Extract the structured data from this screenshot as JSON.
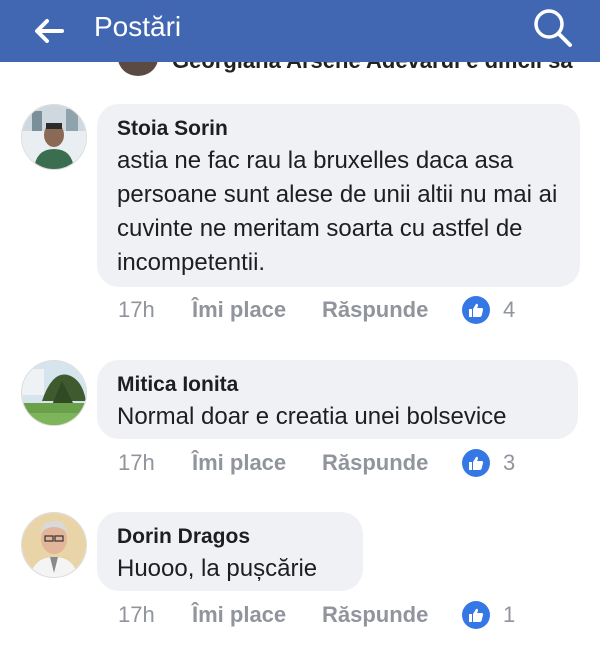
{
  "header": {
    "title": "Postări",
    "bar_color": "#4267b2"
  },
  "peek": {
    "text": "Georgiana Arsene Adevărul e dificil să"
  },
  "comments": [
    {
      "author": "Stoia Sorin",
      "text": "astia ne fac rau la bruxelles daca asa persoane sunt alese de unii altii nu mai ai cuvinte ne meritam soarta cu astfel de incompetentii.",
      "time": "17h",
      "like_label": "Îmi place",
      "reply_label": "Răspunde",
      "reactions": "4"
    },
    {
      "author": "Mitica Ionita",
      "text": "Normal doar e creatia unei bolsevice",
      "time": "17h",
      "like_label": "Îmi place",
      "reply_label": "Răspunde",
      "reactions": "3"
    },
    {
      "author": "Dorin Dragos",
      "text": "Huooo, la pușcărie",
      "time": "17h",
      "like_label": "Îmi place",
      "reply_label": "Răspunde",
      "reactions": "1"
    }
  ],
  "icons": {
    "back": "arrow-left-icon",
    "search": "search-icon",
    "like": "thumbs-up-icon"
  },
  "colors": {
    "bubble": "#f0f1f5",
    "like_badge": "#3578e5",
    "meta_text": "#90949c"
  }
}
